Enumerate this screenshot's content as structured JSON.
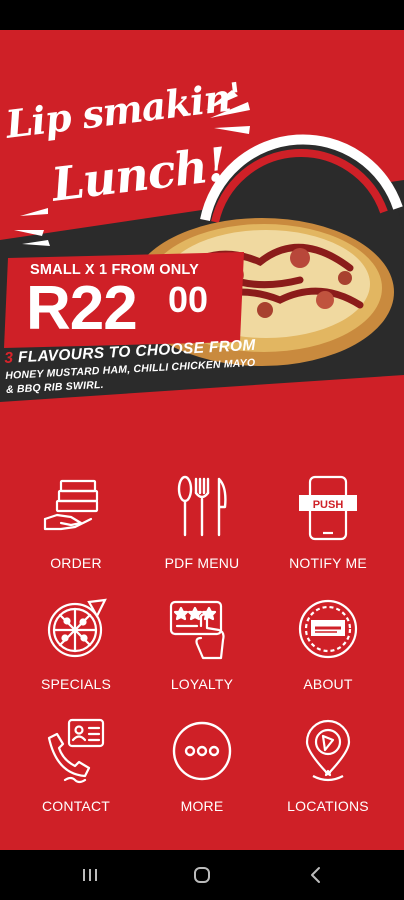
{
  "banner": {
    "headline_line1": "Lip smakin'",
    "headline_line2": "Lunch!",
    "price_label": "SMALL X 1 FROM ONLY",
    "price_main": "R22",
    "price_cents": "00",
    "flavours_count": "3",
    "flavours_title": " FLAVOURS TO CHOOSE FROM",
    "flavours_line1": "HONEY MUSTARD HAM, CHILLI CHICKEN MAYO",
    "flavours_line2": "& BBQ RIB SWIRL."
  },
  "menu": {
    "items": [
      {
        "label": "ORDER",
        "icon": "order-icon"
      },
      {
        "label": "PDF MENU",
        "icon": "fork-knife-icon"
      },
      {
        "label": "NOTIFY ME",
        "icon": "push-phone-icon"
      },
      {
        "label": "SPECIALS",
        "icon": "pizza-icon"
      },
      {
        "label": "LOYALTY",
        "icon": "loyalty-card-icon"
      },
      {
        "label": "ABOUT",
        "icon": "brand-logo-icon"
      },
      {
        "label": "CONTACT",
        "icon": "phone-contact-icon"
      },
      {
        "label": "MORE",
        "icon": "more-icon"
      },
      {
        "label": "LOCATIONS",
        "icon": "location-pin-icon"
      }
    ],
    "push_text": "PUSH"
  },
  "colors": {
    "brand_red": "#cf2027",
    "dark_band": "#2b2b2b",
    "white": "#ffffff"
  },
  "nav": {
    "recent": "recent-apps-icon",
    "home": "home-icon",
    "back": "back-icon"
  }
}
